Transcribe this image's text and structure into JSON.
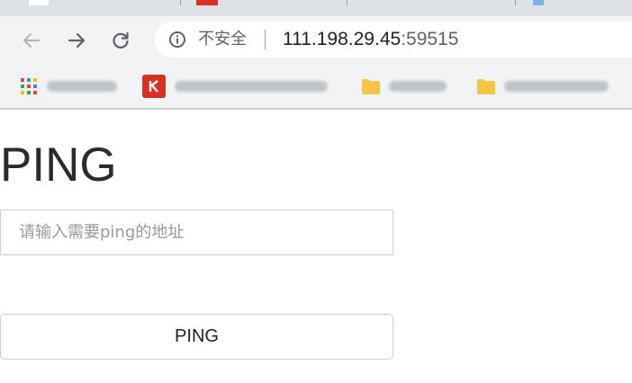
{
  "browser": {
    "security_label": "不安全",
    "url_host": "111.198.29.45",
    "url_port": ":59515",
    "bookmarks": [
      {
        "icon": "apps-grid-icon",
        "label": ""
      },
      {
        "icon": "red-site-icon",
        "label": ""
      },
      {
        "icon": "folder-icon",
        "label": ""
      },
      {
        "icon": "folder-icon",
        "label": ""
      }
    ],
    "colors": {
      "chrome_bg": "#f1f3f4",
      "tabstrip_bg": "#dee1e6",
      "omnibox_bg": "#ffffff",
      "folder": "#f6c543",
      "red_site": "#d93025"
    }
  },
  "page": {
    "title": "PING",
    "input": {
      "value": "",
      "placeholder": "请输入需要ping的地址"
    },
    "button_label": "PING"
  }
}
